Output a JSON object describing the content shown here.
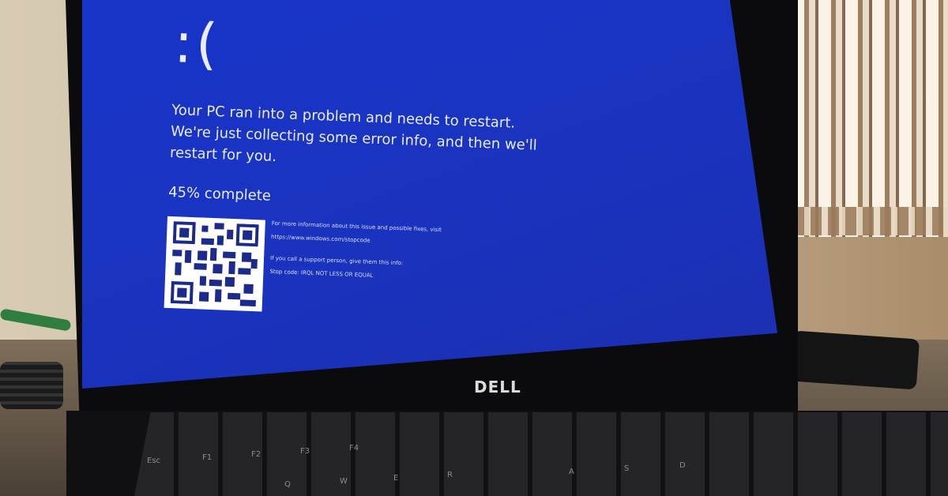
{
  "bsod": {
    "emoticon": ":(",
    "message": "Your PC ran into a problem and needs to restart. We're just collecting some error info, and then we'll restart for you.",
    "progress_percent": 45,
    "progress_text": "45% complete",
    "info_line": "For more information about this issue and possible fixes, visit",
    "info_url": "https://www.windows.com/stopcode",
    "support_line": "If you call a support person, give them this info:",
    "stop_code": "Stop code: IRQL NOT LESS OR EQUAL"
  },
  "hardware": {
    "brand_logo": "DELL",
    "keys": [
      "Esc",
      "F1",
      "F2",
      "F3",
      "F4",
      "Q",
      "W",
      "E",
      "R",
      "A",
      "S",
      "D"
    ]
  },
  "colors": {
    "bsod_blue": "#1a34c2",
    "text": "#e8ecff"
  }
}
